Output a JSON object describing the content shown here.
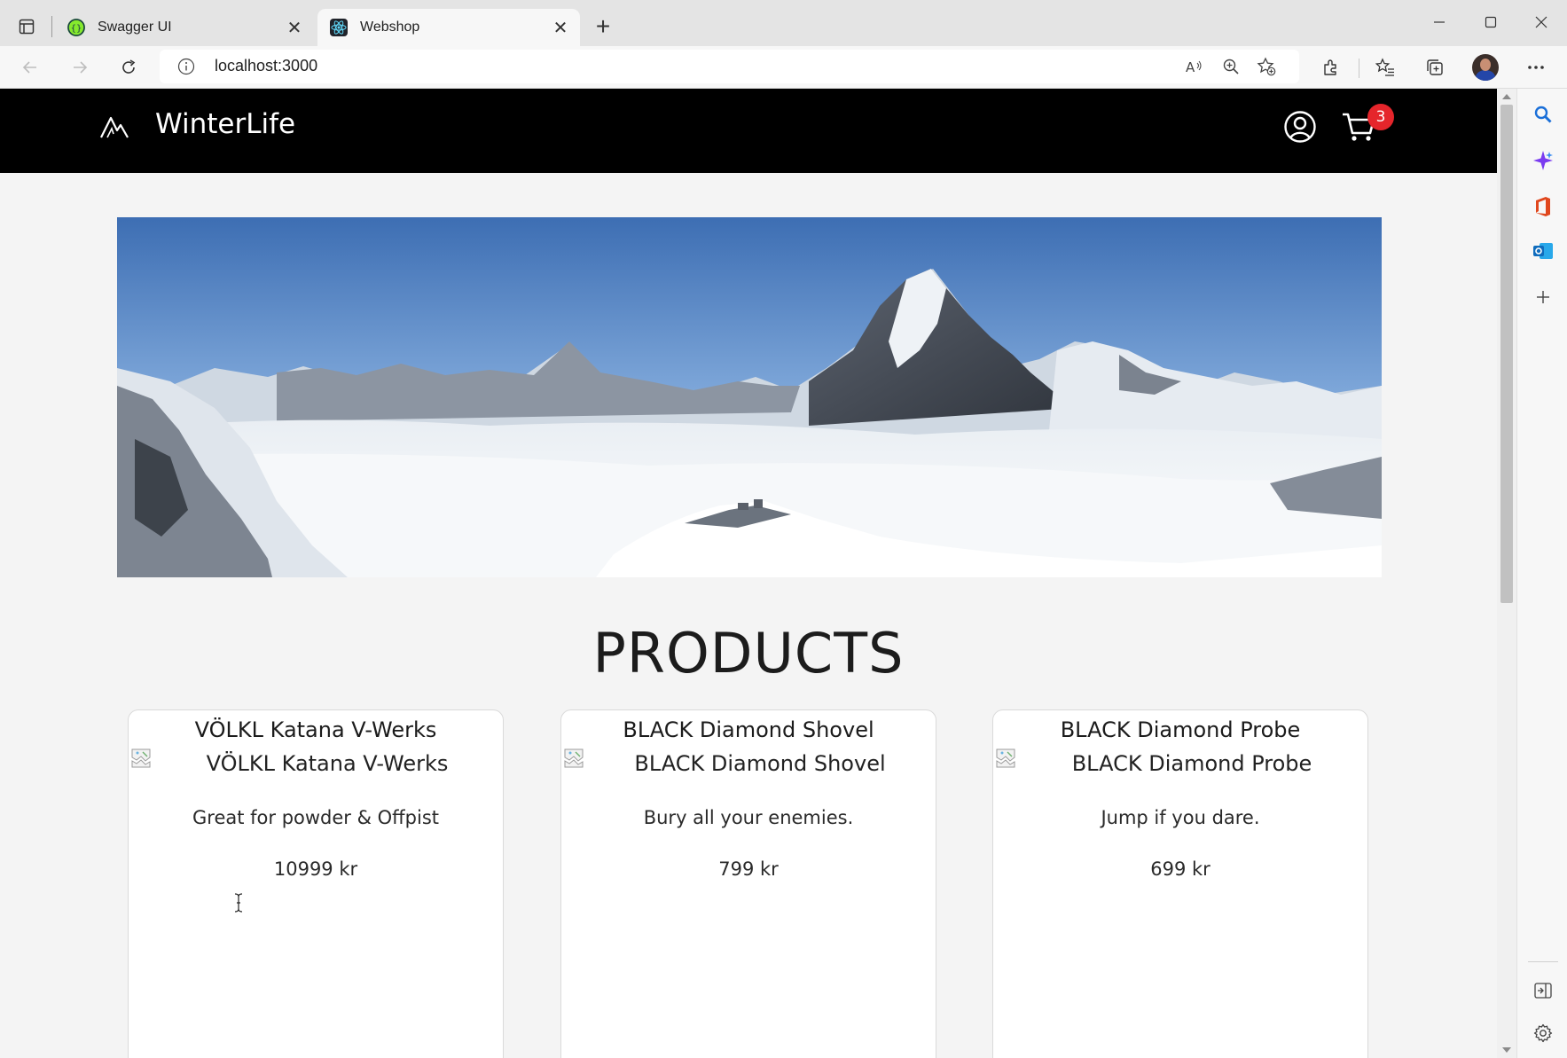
{
  "browser": {
    "tabs": [
      {
        "title": "Swagger UI",
        "favicon": "swagger-icon",
        "active": false
      },
      {
        "title": "Webshop",
        "favicon": "react-icon",
        "active": true
      }
    ],
    "url": "localhost:3000"
  },
  "site": {
    "brand": "WinterLife",
    "cart_count": "3",
    "products_heading": "PRODUCTS"
  },
  "products": [
    {
      "name": "VÖLKL Katana V-Werks",
      "image_alt": "VÖLKL Katana V-Werks",
      "description": "Great for powder & Offpist",
      "price": "10999 kr"
    },
    {
      "name": "BLACK Diamond Shovel",
      "image_alt": "BLACK Diamond Shovel",
      "description": "Bury all your enemies.",
      "price": "799 kr"
    },
    {
      "name": "BLACK Diamond Probe",
      "image_alt": "BLACK Diamond Probe",
      "description": "Jump if you dare.",
      "price": "699 kr"
    }
  ],
  "colors": {
    "header_bg": "#000000",
    "page_bg": "#f4f4f4",
    "badge": "#e5252b",
    "card_bg": "#ffffff"
  }
}
